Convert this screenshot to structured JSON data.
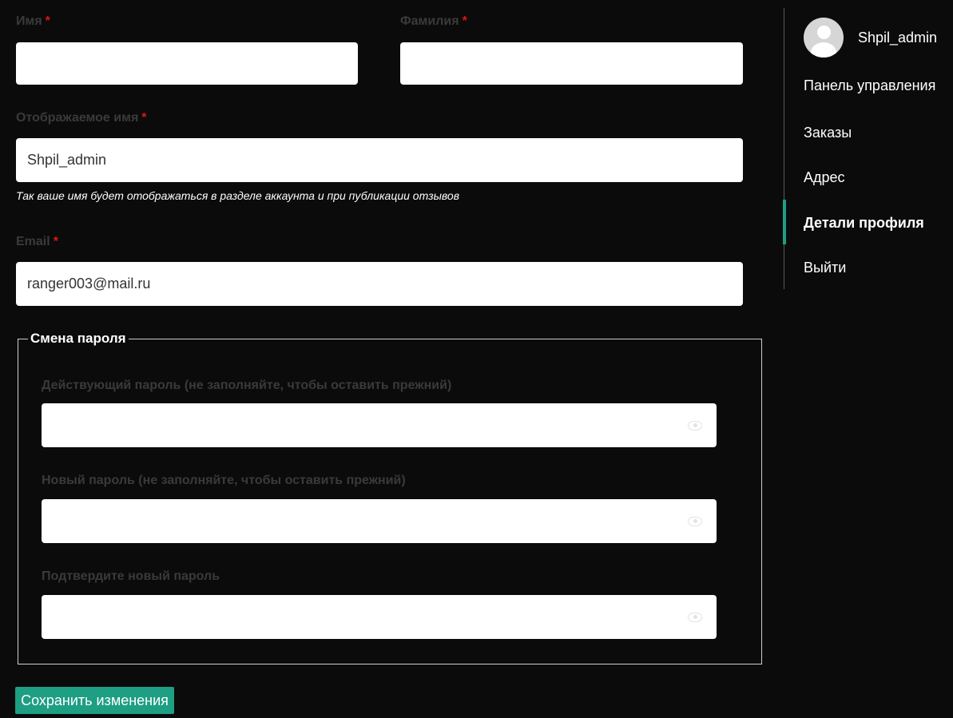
{
  "form": {
    "first_name": {
      "label": "Имя",
      "required_mark": "*",
      "value": ""
    },
    "last_name": {
      "label": "Фамилия",
      "required_mark": "*",
      "value": ""
    },
    "display_name": {
      "label": "Отображаемое имя",
      "required_mark": "*",
      "value": "Shpil_admin",
      "hint": "Так ваше имя будет отображаться в разделе аккаунта и при публикации отзывов"
    },
    "email": {
      "label": "Email",
      "required_mark": "*",
      "value": "ranger003@mail.ru"
    }
  },
  "password_change": {
    "legend": "Смена пароля",
    "current": {
      "label": "Действующий пароль (не заполняйте, чтобы оставить прежний)",
      "value": "",
      "icon": "eye-icon"
    },
    "new": {
      "label": "Новый пароль (не заполняйте, чтобы оставить прежний)",
      "value": "",
      "icon": "eye-icon"
    },
    "confirm": {
      "label": "Подтвердите новый пароль",
      "value": "",
      "icon": "eye-icon"
    }
  },
  "save_button": {
    "label": "Сохранить изменения"
  },
  "sidebar": {
    "username": "Shpil_admin",
    "avatar_icon": "user-avatar-icon",
    "items": [
      {
        "label": "Панель управления",
        "active": false
      },
      {
        "label": "Заказы",
        "active": false
      },
      {
        "label": "Адрес",
        "active": false
      },
      {
        "label": "Детали профиля",
        "active": true
      },
      {
        "label": "Выйти",
        "active": false
      }
    ]
  },
  "colors": {
    "background": "#0b0b0b",
    "accent": "#1e9e83",
    "required": "#e11414",
    "muted_label": "#3a3a3a"
  }
}
